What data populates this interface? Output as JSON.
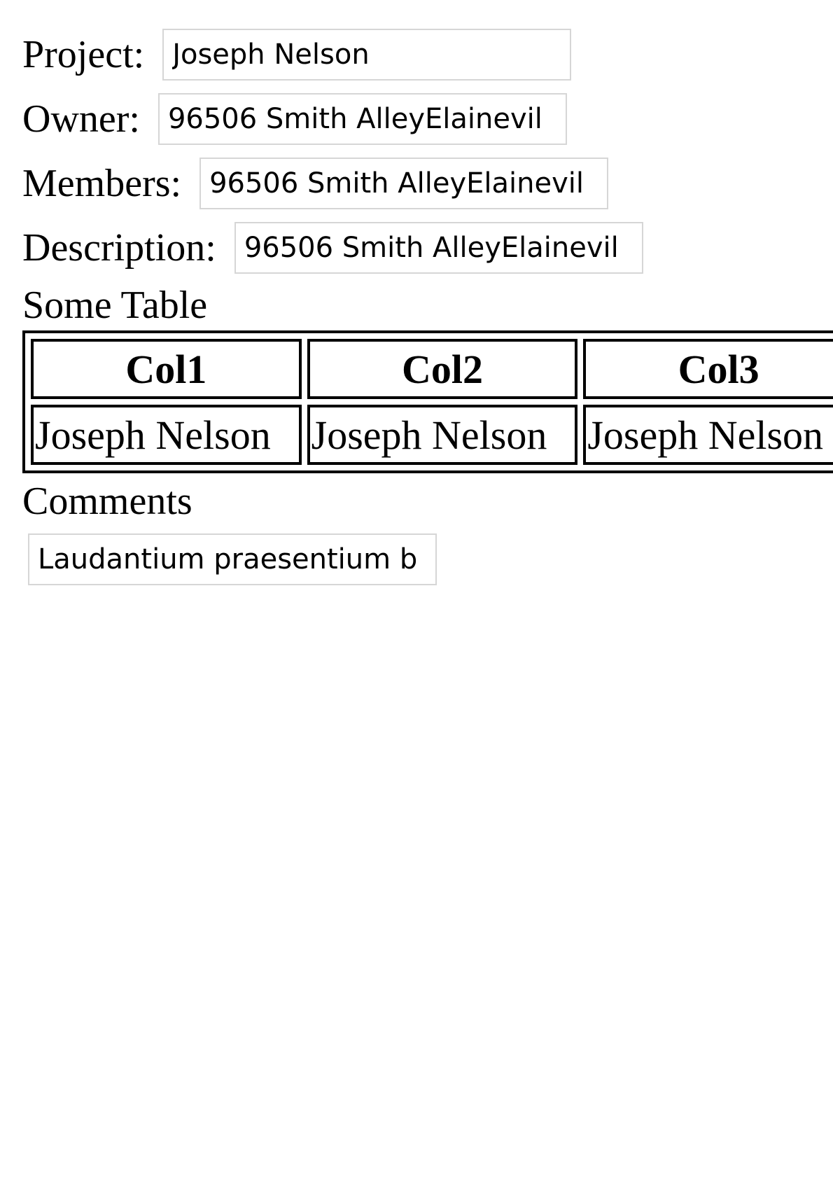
{
  "form": {
    "project": {
      "label": "Project:",
      "value": "Joseph Nelson"
    },
    "owner": {
      "label": "Owner:",
      "value": "96506 Smith AlleyElainevil"
    },
    "members": {
      "label": "Members:",
      "value": "96506 Smith AlleyElainevil"
    },
    "description": {
      "label": "Description:",
      "value": "96506 Smith AlleyElainevil"
    }
  },
  "table": {
    "heading": "Some Table",
    "columns": [
      "Col1",
      "Col2",
      "Col3"
    ],
    "rows": [
      [
        "Joseph Nelson",
        "Joseph Nelson",
        "Joseph Nelson"
      ]
    ]
  },
  "comments": {
    "heading": "Comments",
    "value": "Laudantium praesentium b"
  }
}
